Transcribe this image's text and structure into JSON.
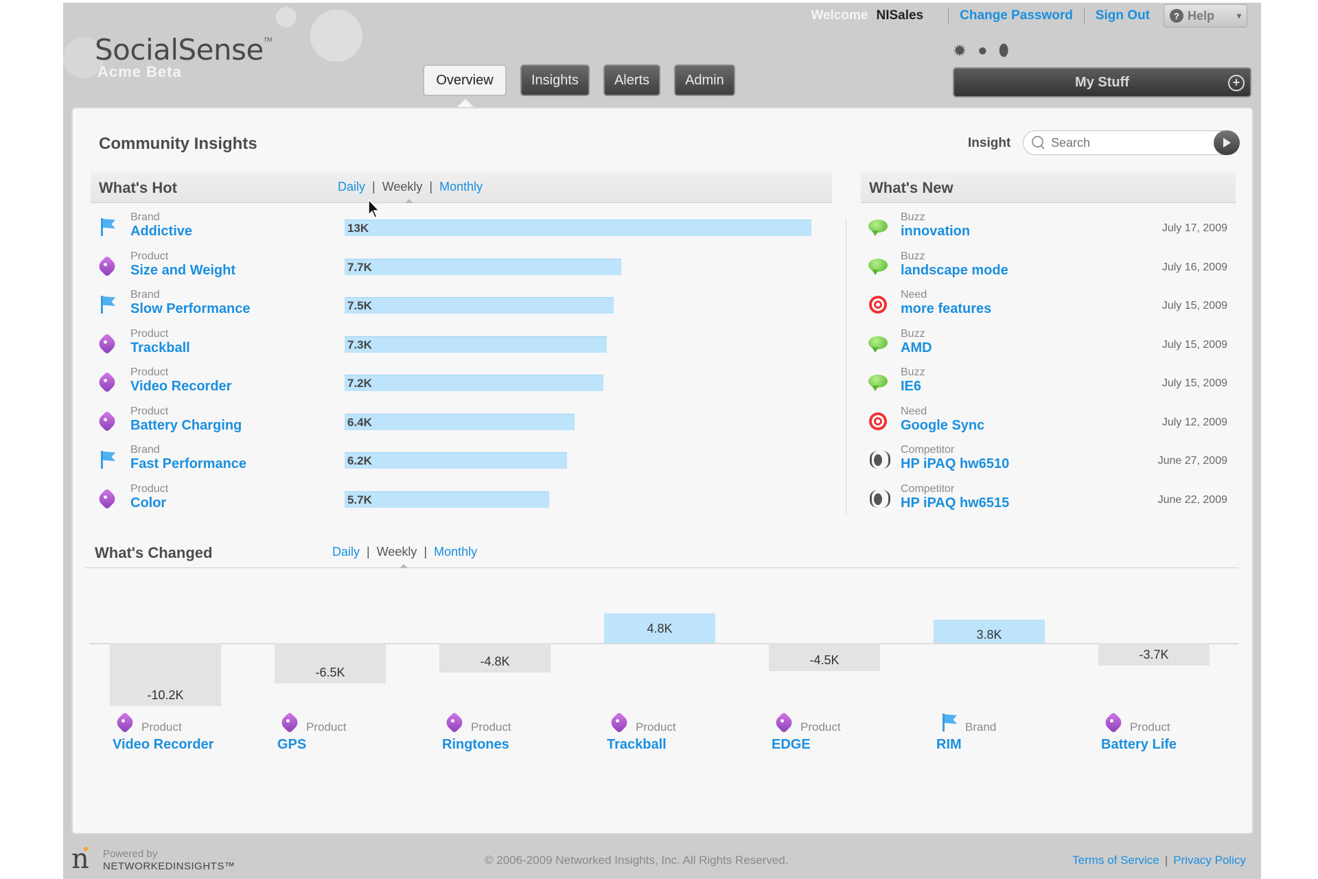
{
  "header": {
    "logo_title": "SocialSense",
    "logo_tm": "TM",
    "logo_sub": "Acme Beta",
    "welcome_word": "Welcome",
    "username": "NISales",
    "change_password": "Change Password",
    "sign_out": "Sign Out",
    "help": "Help",
    "my_stuff": "My Stuff"
  },
  "nav": {
    "tabs": [
      {
        "label": "Overview",
        "active": true
      },
      {
        "label": "Insights",
        "active": false
      },
      {
        "label": "Alerts",
        "active": false
      },
      {
        "label": "Admin",
        "active": false
      }
    ]
  },
  "util_icons": [
    "gear-icon",
    "chat-icon",
    "lightbulb-icon"
  ],
  "main": {
    "title": "Community Insights",
    "insight_label": "Insight",
    "search_placeholder": "Search"
  },
  "period_selector": {
    "daily": "Daily",
    "weekly": "Weekly",
    "monthly": "Monthly",
    "selected": "Weekly"
  },
  "whats_hot": {
    "title": "What's Hot",
    "items": [
      {
        "category": "Brand",
        "name": "Addictive",
        "value_label": "13K",
        "value": 13000,
        "icon": "flag-icon"
      },
      {
        "category": "Product",
        "name": "Size and Weight",
        "value_label": "7.7K",
        "value": 7700,
        "icon": "tag-icon"
      },
      {
        "category": "Brand",
        "name": "Slow Performance",
        "value_label": "7.5K",
        "value": 7500,
        "icon": "flag-icon"
      },
      {
        "category": "Product",
        "name": "Trackball",
        "value_label": "7.3K",
        "value": 7300,
        "icon": "tag-icon"
      },
      {
        "category": "Product",
        "name": "Video Recorder",
        "value_label": "7.2K",
        "value": 7200,
        "icon": "tag-icon"
      },
      {
        "category": "Product",
        "name": "Battery Charging",
        "value_label": "6.4K",
        "value": 6400,
        "icon": "tag-icon"
      },
      {
        "category": "Brand",
        "name": "Fast Performance",
        "value_label": "6.2K",
        "value": 6200,
        "icon": "flag-icon"
      },
      {
        "category": "Product",
        "name": "Color",
        "value_label": "5.7K",
        "value": 5700,
        "icon": "tag-icon"
      }
    ]
  },
  "whats_new": {
    "title": "What's New",
    "items": [
      {
        "category": "Buzz",
        "name": "innovation",
        "date": "July 17, 2009",
        "icon": "buzz-icon"
      },
      {
        "category": "Buzz",
        "name": "landscape mode",
        "date": "July 16, 2009",
        "icon": "buzz-icon"
      },
      {
        "category": "Need",
        "name": "more features",
        "date": "July 15, 2009",
        "icon": "need-icon"
      },
      {
        "category": "Buzz",
        "name": "AMD",
        "date": "July 15, 2009",
        "icon": "buzz-icon"
      },
      {
        "category": "Buzz",
        "name": "IE6",
        "date": "July 15, 2009",
        "icon": "buzz-icon"
      },
      {
        "category": "Need",
        "name": "Google Sync",
        "date": "July 12, 2009",
        "icon": "need-icon"
      },
      {
        "category": "Competitor",
        "name": "HP iPAQ hw6510",
        "date": "June 27, 2009",
        "icon": "competitor-icon"
      },
      {
        "category": "Competitor",
        "name": "HP iPAQ hw6515",
        "date": "June 22, 2009",
        "icon": "competitor-icon"
      }
    ]
  },
  "whats_changed": {
    "title": "What's Changed",
    "items": [
      {
        "category": "Product",
        "name": "Video Recorder",
        "value_label": "-10.2K",
        "value": -10200,
        "icon": "tag-icon"
      },
      {
        "category": "Product",
        "name": "GPS",
        "value_label": "-6.5K",
        "value": -6500,
        "icon": "tag-icon"
      },
      {
        "category": "Product",
        "name": "Ringtones",
        "value_label": "-4.8K",
        "value": -4800,
        "icon": "tag-icon"
      },
      {
        "category": "Product",
        "name": "Trackball",
        "value_label": "4.8K",
        "value": 4800,
        "icon": "tag-icon"
      },
      {
        "category": "Product",
        "name": "EDGE",
        "value_label": "-4.5K",
        "value": -4500,
        "icon": "tag-icon"
      },
      {
        "category": "Brand",
        "name": "RIM",
        "value_label": "3.8K",
        "value": 3800,
        "icon": "flag-icon"
      },
      {
        "category": "Product",
        "name": "Battery Life",
        "value_label": "-3.7K",
        "value": -3700,
        "icon": "tag-icon"
      }
    ]
  },
  "footer": {
    "powered_by": "Powered by",
    "brand": "NETWORKEDINSIGHTS™",
    "copyright": "© 2006-2009 Networked Insights, Inc. All Rights Reserved.",
    "terms": "Terms of Service",
    "separator": "|",
    "privacy": "Privacy Policy"
  },
  "colors": {
    "accent_link": "#1a8fe0",
    "bar_positive": "#bde4fb",
    "bar_negative": "#e3e3e3",
    "chrome": "#cdcdcd"
  }
}
